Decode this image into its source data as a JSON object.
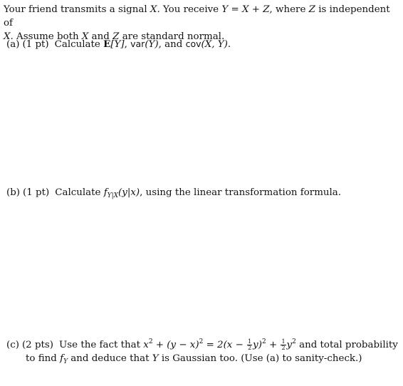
{
  "intro": {
    "text_1": "Your friend transmits a signal ",
    "X": "X",
    "text_2": ". You receive ",
    "equation": "Y = X + Z",
    "text_3": ", where ",
    "Z": "Z",
    "text_4": " is independent of ",
    "X2": "X",
    "text_5": ". Assume both ",
    "X3": "X",
    "text_6": " and ",
    "Z2": "Z",
    "text_7": " are standard normal."
  },
  "parts": [
    {
      "label": "(a)",
      "points": "(1 pt)",
      "text_1": "Calculate ",
      "expectation": "E",
      "exp_arg": "[Y]",
      "sep_1": ", ",
      "var": "var",
      "var_arg": "(Y)",
      "sep_2": ", and ",
      "cov": "cov",
      "cov_arg": "(X, Y)",
      "end": "."
    },
    {
      "label": "(b)",
      "points": "(1 pt)",
      "text_1": "Calculate ",
      "f": "f",
      "sub": "Y|X",
      "arg": "(y|x)",
      "text_2": ", using the linear transformation formula."
    },
    {
      "label": "(c)",
      "points": "(2 pts)",
      "text_1": "Use the fact that ",
      "eq_lhs_a": "x",
      "eq_sup": "2",
      "eq_plus": " + (y − x)",
      "eq_equals": " = 2(x − ",
      "frac_num": "1",
      "frac_den": "2",
      "eq_y": "y)",
      "eq_plus2": " + ",
      "eq_y2": "y",
      "text_2": " and total probability",
      "line2_1": "to find ",
      "fY": "f",
      "fY_sub": "Y",
      "line2_2": " and deduce that ",
      "Y": "Y",
      "line2_3": " is Gaussian too. (Use (a) to sanity-check.)"
    }
  ]
}
